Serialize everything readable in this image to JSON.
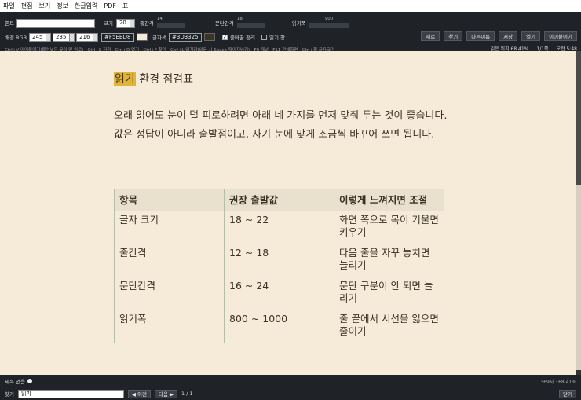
{
  "menubar": [
    "파일",
    "편집",
    "보기",
    "정보",
    "한글입력",
    "PDF",
    "표"
  ],
  "toolbar": {
    "font_label": "폰트",
    "font_value": "",
    "size_label": "크기",
    "size_value": "20",
    "line_spacing_label": "줄간격",
    "line_spacing_value": "14",
    "para_spacing_label": "문단간격",
    "para_spacing_value": "18",
    "read_width_label": "읽기폭",
    "read_width_value": "900",
    "bg_label": "배경 RGB",
    "bg_r": "245",
    "bg_g": "235",
    "bg_b": "216",
    "bg_hex": "#F5EBD8",
    "text_color_label": "글자색",
    "text_hex": "#3D3325",
    "wrap_label": "줄바꿈 정리",
    "wrap_checked": "✓",
    "readwin_label": "읽기 창",
    "shortcuts": "Ctrl+V 이어붙이기(붙여넣은 곳이 맨 위로) · Ctrl+S 저장 · Ctrl+O 열기 · Ctrl+F 찾기 · Ctrl+L 읽기창(읽음 시 Space 페이지넘김) · F9 패널 · F11 전체화면 · Ctrl+휠 글자크기",
    "buttons": [
      "새로",
      "찾기",
      "다른이름",
      "저장",
      "열기",
      "이어붙이기"
    ],
    "read_position": "읽은 위치 68.41%",
    "page": "1/1쪽",
    "time": "오전 5:48"
  },
  "document": {
    "title_highlight": "읽기",
    "title_rest": " 환경 점검표",
    "paragraph": "오래 읽어도 눈이 덜 피로하려면 아래 네 가지를 먼저 맞춰 두는 것이 좋습니다. 값은 정답이 아니라 출발점이고, 자기 눈에 맞게 조금씩 바꾸어 쓰면 됩니다.",
    "table": {
      "headers": [
        "항목",
        "권장 출발값",
        "이렇게 느껴지면 조절"
      ],
      "rows": [
        [
          "글자 크기",
          "18 ~ 22",
          "화면 쪽으로 목이 기울면 키우기"
        ],
        [
          "줄간격",
          "12 ~ 18",
          "다음 줄을 자꾸 놓치면 늘리기"
        ],
        [
          "문단간격",
          "16 ~ 24",
          "문단 구분이 안 되면 늘리기"
        ],
        [
          "읽기폭",
          "800 ~ 1000",
          "줄 끝에서 시선을 잃으면 줄이기"
        ]
      ]
    }
  },
  "statusbar": {
    "doc_title": "제목 없음",
    "count": "369자 · 68.41%"
  },
  "findbar": {
    "label": "찾기",
    "query": "읽기",
    "prev": "◀ 이전",
    "next": "다음 ▶",
    "result": "1 / 1",
    "close": "닫기"
  },
  "colors": {
    "background": "#F5EBD8",
    "text": "#3D3325",
    "highlight": "#E0B33A",
    "chrome": "#1F2328"
  }
}
